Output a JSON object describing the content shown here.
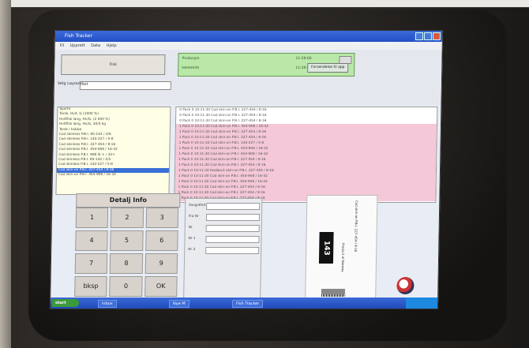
{
  "window": {
    "title": "Fish Tracker"
  },
  "menu": [
    "Fil",
    "Upprett",
    "Data",
    "Hjelp"
  ],
  "top": {
    "big_button": "Fisk",
    "status_rows": [
      {
        "label": "Produsjon",
        "time": "11:59:00"
      },
      {
        "label": "Henteinfo",
        "time": "11:59:00"
      }
    ],
    "right_button": "Forsendelse til app",
    "dropdown_label": "Velg Layout",
    "dropdown_value": "filet"
  },
  "left_list": [
    "Sporfe",
    "Torsk, Hvit, G (1000 %)",
    "Hvitfisk lang, Hv/G, (2 000 %)",
    "Hvitfisk lang, Hv/G, 30/4 kg",
    "Torsk i hobbe",
    "Cod skinless P.B.I. 85-142 / 2/6",
    "Cod skinless P.B.I. 142-227 / 5-8",
    "Cod skinless P.B.I. 227-454 / 8-16",
    "Cod skinless P.B.I. 454-908 / 16-32",
    "Cod skinless P.B.I. 908 lb + / 32+",
    "Cod skinless P.B.I. 85-142 / 2/5",
    "Cod skinless P.B.I. 142-227 / 5-8",
    "Cod skin-on P.B.I. 227-454 / 8-16",
    "Cod skin-on P.B.I. 454-908 / 16-32"
  ],
  "left_selected_index": 12,
  "right_list": [
    {
      "text": "0  Pack  0   10:11:30   Cod skin-on P.B.I. 227-454 / 8-16",
      "pink": false
    },
    {
      "text": "0  Pack  0   10:11:30   Cod skin-on P.B.I. 227-454 / 8-16",
      "pink": false
    },
    {
      "text": "0  Pack  0   10:11:30   Cod skin-on P.B.I. 227-454 / 8-16",
      "pink": false
    },
    {
      "text": "1  Pack  0   10:11:30   Cod skin-on P.B.I. 454-908 / 16-32",
      "pink": true
    },
    {
      "text": "1  Pack  0   10:11:30   Cod skin-on P.B.I. 227-454 / 8-16",
      "pink": true
    },
    {
      "text": "1  Pack  0   10:11:30   Cod skin-on P.B.I. 227-454 / 8-16",
      "pink": true
    },
    {
      "text": "1  Pack  0   10:11:30   Cod skin-on P.B.I. 142-227 / 5-8",
      "pink": true
    },
    {
      "text": "1  Pack  0   10:11:30   Cod skin-on P.B.I. 454-908 / 16-32",
      "pink": true
    },
    {
      "text": "1  Pack  0   10:11:30   Cod skin-on P.B.I. 454-908 / 16-32",
      "pink": true
    },
    {
      "text": "1  Pack  0   10:11:30   Cod skin-on P.B.I. 227-454 / 8-16",
      "pink": true
    },
    {
      "text": "1  Pack  0   10:11:30   Cod skin-on P.B.I. 227-454 / 8-16",
      "pink": true
    },
    {
      "text": "1  Pack  0   10:11:30   Haddock skin-on P.B.I. 227-454 / 8-16",
      "pink": true
    },
    {
      "text": "1  Pack  0   10:11:30   Cod skin-on P.B.I. 454-908 / 16-32",
      "pink": true
    },
    {
      "text": "1  Pack  0   10:11:30   Cod skin-on P.B.I. 454-908 / 16-32",
      "pink": true
    },
    {
      "text": "1  Pack  0   10:11:30   Cod skin-on P.B.I. 227-454 / 8-16",
      "pink": true
    },
    {
      "text": "1  Pack  0   10:11:30   Cod skin-on P.B.I. 227-454 / 8-16",
      "pink": true
    },
    {
      "text": "1  Pack  0   10:11:30   Cod skin-on P.B.I. 227-454 / 8-16",
      "pink": true
    }
  ],
  "detail_button": "Detalj Info",
  "keypad": [
    "1",
    "2",
    "3",
    "4",
    "5",
    "6",
    "7",
    "8",
    "9",
    "bksp",
    "0",
    "OK"
  ],
  "form_fields": [
    "Fangstfelt",
    "Fra Nr",
    "Nr",
    "Nr 1",
    "Nr 2"
  ],
  "label": {
    "big_number": "143",
    "lines": [
      "Cod skin-on P.B.I. 227-454 / 8-16",
      "Product of Norway"
    ]
  },
  "taskbar": {
    "start": "start",
    "tasks": [
      "Inbox",
      "Nye M",
      "Fish Tracker"
    ]
  }
}
